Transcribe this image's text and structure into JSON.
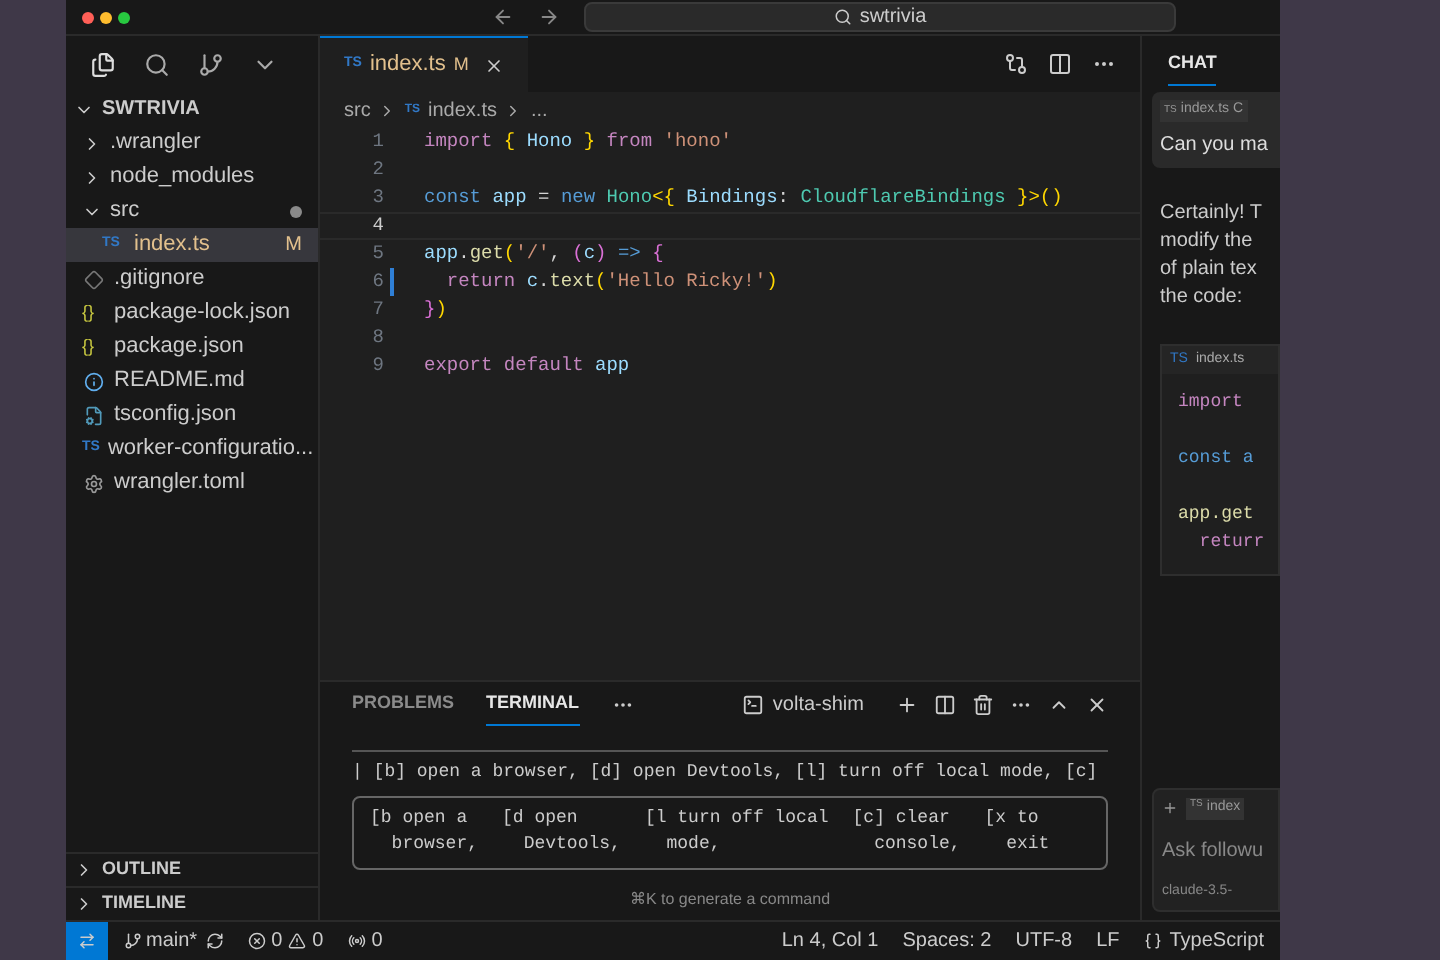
{
  "title_bar": {
    "search": "swtrivia"
  },
  "sidebar": {
    "project": "SWTRIVIA",
    "expanded": true,
    "items": [
      {
        "name": ".wrangler",
        "kind": "folder",
        "expanded": false,
        "selected": false
      },
      {
        "name": "node_modules",
        "kind": "folder",
        "expanded": false,
        "selected": false
      },
      {
        "name": "src",
        "kind": "folder",
        "expanded": true,
        "selected": false,
        "modified_dot": true,
        "children": [
          {
            "name": "index.ts",
            "kind": "ts",
            "icon_text": "TS",
            "status": "M",
            "selected": true
          }
        ]
      },
      {
        "name": ".gitignore",
        "kind": "git",
        "selected": false
      },
      {
        "name": "package-lock.json",
        "kind": "json",
        "icon_text": "{}",
        "selected": false
      },
      {
        "name": "package.json",
        "kind": "json",
        "icon_text": "{}",
        "selected": false
      },
      {
        "name": "README.md",
        "kind": "info",
        "selected": false
      },
      {
        "name": "tsconfig.json",
        "kind": "config",
        "selected": false
      },
      {
        "name": "worker-configuratio...",
        "kind": "ts",
        "icon_text": "TS",
        "selected": false
      },
      {
        "name": "wrangler.toml",
        "kind": "gear",
        "selected": false
      }
    ],
    "sections": [
      {
        "label": "OUTLINE",
        "expanded": false
      },
      {
        "label": "TIMELINE",
        "expanded": false
      }
    ]
  },
  "editor": {
    "tabs": [
      {
        "icon_text": "TS",
        "label": "index.ts",
        "status": "M",
        "selected": true
      }
    ],
    "breadcrumb": [
      {
        "label": "src"
      },
      {
        "icon_text": "TS",
        "label": "index.ts"
      },
      {
        "label": "..."
      }
    ],
    "lines": [
      {
        "number": "1",
        "tokens": [
          {
            "text": "import ",
            "kind": "keyword"
          },
          {
            "text": "{ ",
            "kind": "brace"
          },
          {
            "text": "Hono ",
            "kind": "variable"
          },
          {
            "text": "} ",
            "kind": "brace"
          },
          {
            "text": "from ",
            "kind": "keyword"
          },
          {
            "text": "'hono'",
            "kind": "string"
          }
        ]
      },
      {
        "number": "2"
      },
      {
        "number": "3",
        "tokens": [
          {
            "text": "const ",
            "kind": "storage"
          },
          {
            "text": "app ",
            "kind": "variable"
          },
          {
            "text": "= ",
            "kind": "plain"
          },
          {
            "text": "new ",
            "kind": "storage"
          },
          {
            "text": "Hono",
            "kind": "type"
          },
          {
            "text": "<{ ",
            "kind": "brace"
          },
          {
            "text": "Bindings",
            "kind": "variable"
          },
          {
            "text": ": ",
            "kind": "plain"
          },
          {
            "text": "CloudflareBindings ",
            "kind": "type"
          },
          {
            "text": "}>()",
            "kind": "brace"
          }
        ]
      },
      {
        "number": "4",
        "current": true
      },
      {
        "number": "5",
        "tokens": [
          {
            "text": "app",
            "kind": "variable"
          },
          {
            "text": ".",
            "kind": "plain"
          },
          {
            "text": "get",
            "kind": "function"
          },
          {
            "text": "(",
            "kind": "brace"
          },
          {
            "text": "'/'",
            "kind": "string"
          },
          {
            "text": ", ",
            "kind": "plain"
          },
          {
            "text": "(",
            "kind": "paren"
          },
          {
            "text": "c",
            "kind": "variable"
          },
          {
            "text": ") ",
            "kind": "paren"
          },
          {
            "text": "=> ",
            "kind": "storage"
          },
          {
            "text": "{",
            "kind": "paren"
          }
        ]
      },
      {
        "number": "6",
        "changed": true,
        "tokens": [
          {
            "text": "  return ",
            "kind": "keyword"
          },
          {
            "text": "c",
            "kind": "variable"
          },
          {
            "text": ".",
            "kind": "plain"
          },
          {
            "text": "text",
            "kind": "function"
          },
          {
            "text": "(",
            "kind": "brace"
          },
          {
            "text": "'Hello Ricky!'",
            "kind": "string"
          },
          {
            "text": ")",
            "kind": "brace"
          }
        ]
      },
      {
        "number": "7",
        "tokens": [
          {
            "text": "}",
            "kind": "paren"
          },
          {
            "text": ")",
            "kind": "brace"
          }
        ]
      },
      {
        "number": "8"
      },
      {
        "number": "9",
        "tokens": [
          {
            "text": "export ",
            "kind": "keyword"
          },
          {
            "text": "default ",
            "kind": "keyword"
          },
          {
            "text": "app",
            "kind": "variable"
          }
        ]
      }
    ]
  },
  "panel": {
    "tabs": [
      {
        "label": "PROBLEMS",
        "selected": false
      },
      {
        "label": "TERMINAL",
        "selected": true
      }
    ],
    "terminal_name": "volta-shim",
    "lines": [
      "| [b] open a browser, [d] open Devtools, [l] turn off local mode, [c]"
    ],
    "box_columns": [
      {
        "lines": [
          "[b open a",
          "  browser,"
        ]
      },
      {
        "lines": [
          "[d open",
          "  Devtools,"
        ]
      },
      {
        "lines": [
          "[l turn off local",
          "  mode,"
        ]
      },
      {
        "lines": [
          "[c] clear",
          "  console,"
        ]
      },
      {
        "lines": [
          "[x to",
          "  exit"
        ]
      }
    ],
    "hint": "⌘K to generate a command"
  },
  "chat": {
    "tab": "CHAT",
    "message": {
      "chip_icon_text": "TS",
      "chip": "index.ts C",
      "text": "Can you ma"
    },
    "reply": [
      "Certainly! T",
      "modify the",
      "of plain tex",
      "the code:"
    ],
    "code_block": {
      "icon_text": "TS",
      "file": "index.ts",
      "lines": [
        {
          "text": "import",
          "kind": "keyword"
        },
        {
          "kind": "blank"
        },
        {
          "text": "const a",
          "kind": "storage"
        },
        {
          "kind": "blank"
        },
        {
          "text": "app.get",
          "kind": "function"
        },
        {
          "text": "  returr",
          "kind": "keyword"
        }
      ]
    },
    "input": {
      "chip_icon_text": "TS",
      "chip": "index",
      "placeholder": "Ask followu",
      "model": "claude-3.5-"
    }
  },
  "status_bar": {
    "branch": "main*",
    "errors": "0",
    "warnings": "0",
    "ports": "0",
    "right": [
      {
        "label": "Ln 4, Col 1"
      },
      {
        "label": "Spaces: 2"
      },
      {
        "label": "UTF-8"
      },
      {
        "label": "LF"
      },
      {
        "label": "TypeScript",
        "icon": true
      }
    ]
  }
}
